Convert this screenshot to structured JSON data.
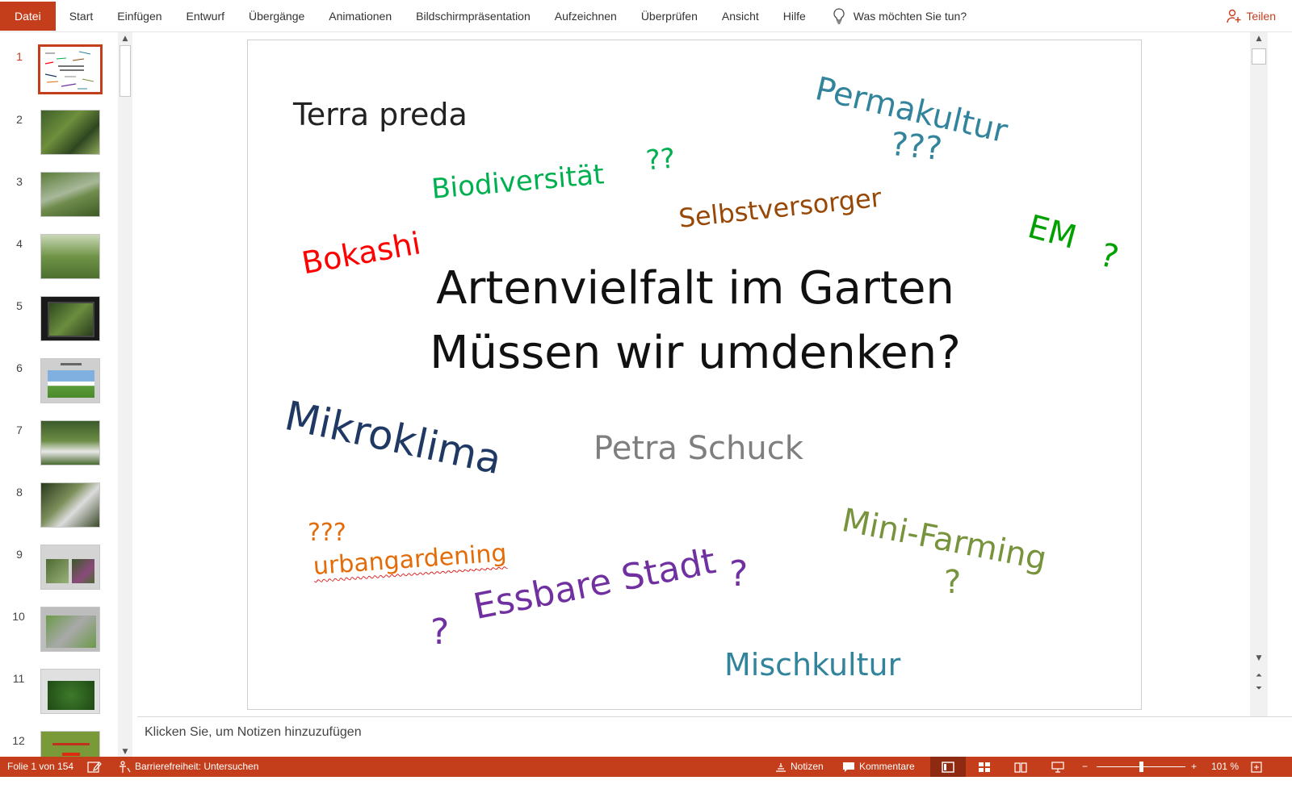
{
  "ribbon": {
    "tabs": [
      "Datei",
      "Start",
      "Einfügen",
      "Entwurf",
      "Übergänge",
      "Animationen",
      "Bildschirmpräsentation",
      "Aufzeichnen",
      "Überprüfen",
      "Ansicht",
      "Hilfe"
    ],
    "tell_me": "Was möchten Sie tun?",
    "share": "Teilen"
  },
  "thumbnails": {
    "numbers": [
      "1",
      "2",
      "3",
      "4",
      "5",
      "6",
      "7",
      "8",
      "9",
      "10",
      "11",
      "12"
    ],
    "selected": "1"
  },
  "slide": {
    "title_line1": "Artenvielfalt im Garten",
    "title_line2": "Müssen wir umdenken?",
    "author": "Petra Schuck",
    "words": {
      "terra_preda": "Terra preda",
      "permakultur": "Permakultur",
      "permakultur_q": "???",
      "biodiversitaet": "Biodiversität",
      "biodiversitaet_q": "??",
      "selbstversorger": "Selbstversorger",
      "em": "EM",
      "em_q": "?",
      "bokashi": "Bokashi",
      "mikroklima": "Mikroklima",
      "mini_farming": "Mini-Farming",
      "mini_farming_q": "?",
      "urban_q": "???",
      "urbangardening": "urbangardening",
      "essbare_stadt": "Essbare Stadt",
      "essbare_q_left": "?",
      "essbare_q_right": "?",
      "mischkultur": "Mischkultur"
    },
    "colors": {
      "teal": "#31849b",
      "green": "#00b050",
      "brown": "#984806",
      "dark_green": "#00a000",
      "red": "#ff0000",
      "navy": "#1f3864",
      "gray": "#7f7f7f",
      "olive": "#77933c",
      "orange": "#e36c09",
      "purple": "#7030a0"
    }
  },
  "notes": {
    "placeholder": "Klicken Sie, um Notizen hinzuzufügen"
  },
  "status": {
    "slide_counter": "Folie 1 von 154",
    "accessibility": "Barrierefreiheit: Untersuchen",
    "notes": "Notizen",
    "comments": "Kommentare",
    "zoom": "101 %",
    "zoom_minus": "−",
    "zoom_plus": "+"
  },
  "theme": {
    "accent": "#c43e1c"
  }
}
